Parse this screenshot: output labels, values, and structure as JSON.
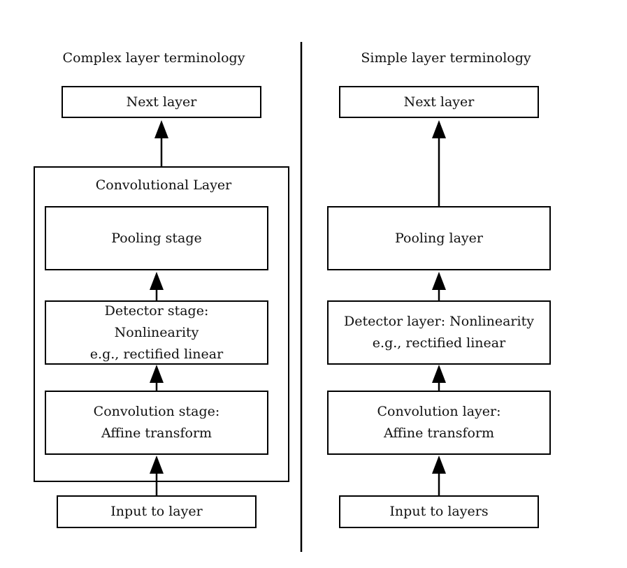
{
  "complex": {
    "title": "Complex layer terminology",
    "next_layer": "Next layer",
    "container_label": "Convolutional Layer",
    "pooling": [
      "Pooling stage"
    ],
    "detector": [
      "Detector stage:",
      "Nonlinearity",
      "e.g., rectified linear"
    ],
    "convolution": [
      "Convolution stage:",
      "Affine transform"
    ],
    "input": "Input to layer"
  },
  "simple": {
    "title": "Simple layer terminology",
    "next_layer": "Next layer",
    "pooling": [
      "Pooling layer"
    ],
    "detector": [
      "Detector layer: Nonlinearity",
      "e.g., rectified linear"
    ],
    "convolution": [
      "Convolution layer:",
      "Affine transform"
    ],
    "input": "Input to layers"
  }
}
